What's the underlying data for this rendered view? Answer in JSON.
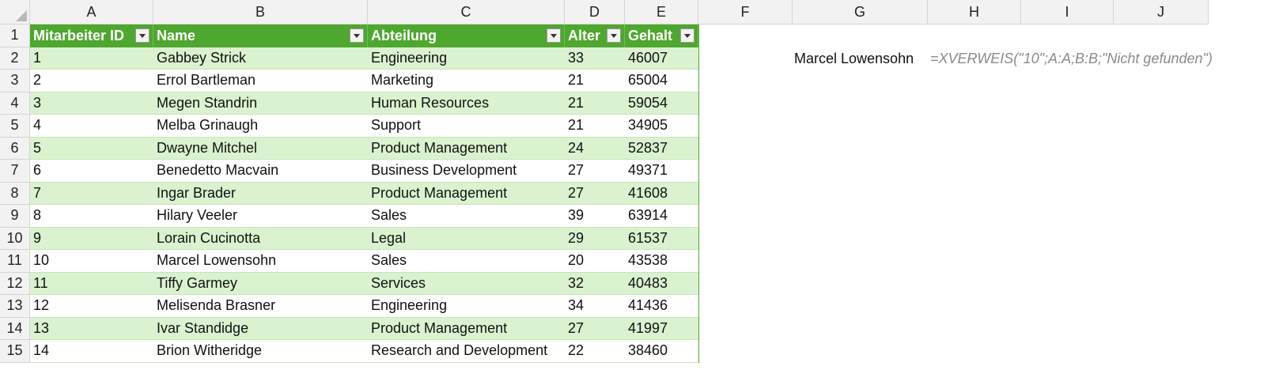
{
  "columns": [
    "A",
    "B",
    "C",
    "D",
    "E",
    "F",
    "G",
    "H",
    "I",
    "J"
  ],
  "row_numbers": [
    "1",
    "2",
    "3",
    "4",
    "5",
    "6",
    "7",
    "8",
    "9",
    "10",
    "11",
    "12",
    "13",
    "14",
    "15"
  ],
  "table": {
    "headers": [
      "Mitarbeiter ID",
      "Name",
      "Abteilung",
      "Alter",
      "Gehalt"
    ],
    "rows": [
      [
        "1",
        "Gabbey Strick",
        "Engineering",
        "33",
        "46007"
      ],
      [
        "2",
        "Errol Bartleman",
        "Marketing",
        "21",
        "65004"
      ],
      [
        "3",
        "Megen Standrin",
        "Human Resources",
        "21",
        "59054"
      ],
      [
        "4",
        "Melba Grinaugh",
        "Support",
        "21",
        "34905"
      ],
      [
        "5",
        "Dwayne Mitchel",
        "Product Management",
        "24",
        "52837"
      ],
      [
        "6",
        "Benedetto Macvain",
        "Business Development",
        "27",
        "49371"
      ],
      [
        "7",
        "Ingar Brader",
        "Product Management",
        "27",
        "41608"
      ],
      [
        "8",
        "Hilary Veeler",
        "Sales",
        "39",
        "63914"
      ],
      [
        "9",
        "Lorain Cucinotta",
        "Legal",
        "29",
        "61537"
      ],
      [
        "10",
        "Marcel Lowensohn",
        "Sales",
        "20",
        "43538"
      ],
      [
        "11",
        "Tiffy Garmey",
        "Services",
        "32",
        "40483"
      ],
      [
        "12",
        "Melisenda Brasner",
        "Engineering",
        "34",
        "41436"
      ],
      [
        "13",
        "Ivar Standidge",
        "Product Management",
        "27",
        "41997"
      ],
      [
        "14",
        "Brion Witheridge",
        "Research and Development",
        "22",
        "38460"
      ]
    ]
  },
  "lookup": {
    "result": "Marcel Lowensohn",
    "formula": "=XVERWEIS(\"10\";A:A;B:B;\"Nicht gefunden\")"
  },
  "colors": {
    "header_green": "#4ea72e",
    "band_green": "#daf2d0",
    "grid": "#d4d4d4"
  },
  "icons": [
    "select-all-corner-icon",
    "filter-dropdown-icon"
  ]
}
